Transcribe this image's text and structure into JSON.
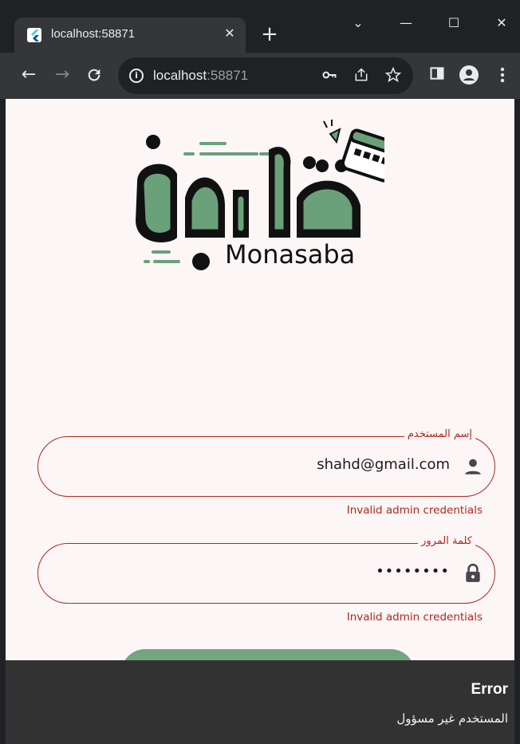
{
  "browser": {
    "tab_title": "localhost:58871",
    "tab_close": "✕",
    "new_tab": "+",
    "url_host": "localhost",
    "url_port": ":58871",
    "window_controls": {
      "minimize": "—",
      "maximize": "☐",
      "close": "✕",
      "tab_search": "⌄"
    },
    "nav": {
      "back": "←",
      "forward": "→",
      "reload": "C"
    }
  },
  "logo": {
    "arabic_text": "مناسبة",
    "latin_text": "Monasaba",
    "colors": {
      "green": "#6aa07a",
      "outline": "#111111"
    }
  },
  "form": {
    "username": {
      "label": "إسم المستخدم",
      "value": "shahd@gmail.com",
      "error": "Invalid admin credentials",
      "icon": "person-icon"
    },
    "password": {
      "label": "كلمة المرور",
      "value": "••••••••",
      "error": "Invalid admin credentials",
      "icon": "lock-icon"
    }
  },
  "snackbar": {
    "title": "Error",
    "message": "المستخدم غير مسؤول"
  },
  "colors": {
    "error": "#b3261e",
    "background": "#fcf7f6",
    "button": "#74a583",
    "snackbar": "#323232"
  }
}
